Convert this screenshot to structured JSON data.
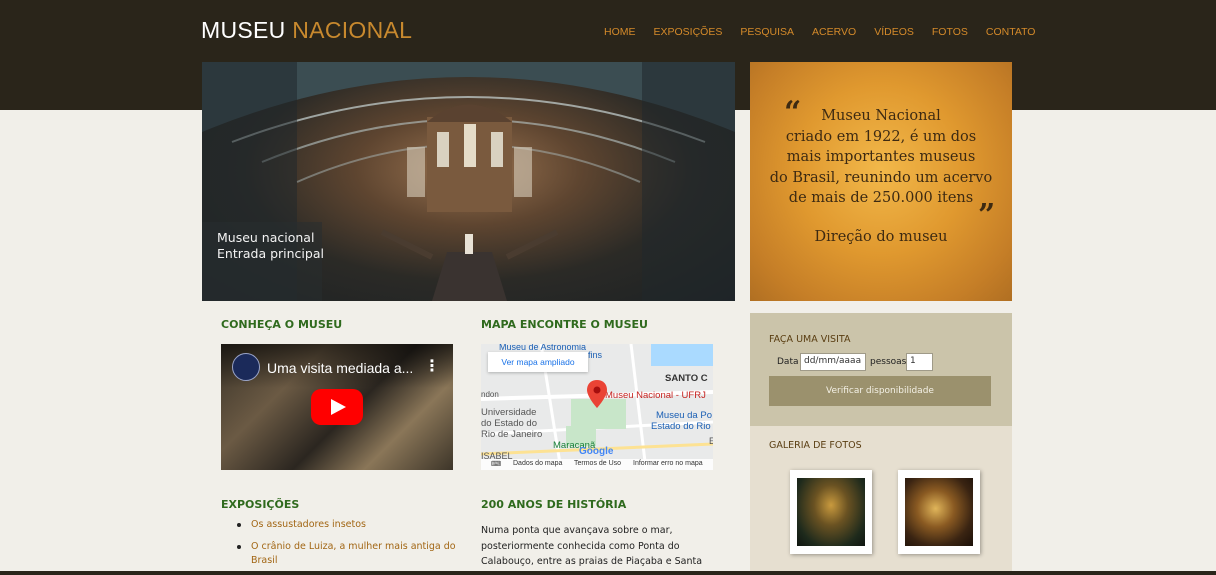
{
  "header": {
    "logo_part1": "MUSEU",
    "logo_part2": "NACIONAL",
    "nav": [
      "HOME",
      "EXPOSIÇÕES",
      "PESQUISA",
      "ACERVO",
      "VÍDEOS",
      "FOTOS",
      "CONTATO"
    ]
  },
  "hero": {
    "caption_line1": "Museu nacional",
    "caption_line2": "Entrada principal"
  },
  "quote": {
    "open_mark": "“",
    "close_mark": "”",
    "lines": [
      "Museu Nacional",
      "criado em 1922, é um dos",
      "mais importantes museus",
      "do Brasil, reunindo um acervo",
      "de mais de 250.000 itens"
    ],
    "signature": "Direção do museu"
  },
  "sections": {
    "conheca": "CONHEÇA O MUSEU",
    "mapa": "MAPA ENCONTRE O MUSEU",
    "exposicoes": "EXPOSIÇÕES",
    "historia": "200 ANOS DE HISTÓRIA"
  },
  "video": {
    "title": "Uma visita mediada a...",
    "menu": "⋮"
  },
  "map": {
    "button": "Ver mapa ampliado",
    "labels": {
      "museu_astronomia": "Museu de Astronomia",
      "fins": "fins",
      "santo": "SANTO C",
      "ndon": "ndon",
      "museu_nacional": "Museu Nacional - UFRJ",
      "museu_da_po": "Museu da Po",
      "estado_do_rio": "Estado do Rio",
      "universidade": "Universidade",
      "do_estado": "do Estado do",
      "rio_de_janeiro": "Rio de Janeiro",
      "maracana": "Maracanã",
      "google": "Google",
      "isabel": "ISABEL",
      "e": "E"
    },
    "footer": [
      "Dados do mapa",
      "Termos de Uso",
      "Informar erro no mapa"
    ]
  },
  "exposicoes_list": [
    "Os assustadores insetos",
    "O crânio de Luiza, a mulher mais antiga do Brasil"
  ],
  "historia_text": "Numa ponta que avançava sobre o mar, posteriormente conhecida como Ponta do Calabouço, entre as praias de Piaçaba e Santa Luzia, no centro histórico do Rio de Janeiro, se",
  "visit": {
    "title": "FAÇA UMA VISITA",
    "data_label": "Data",
    "data_placeholder": "dd/mm/aaaa",
    "pessoas_label": "pessoas",
    "pessoas_value": "1",
    "button": "Verificar disponibilidade"
  },
  "gallery": {
    "title": "GALERIA DE FOTOS"
  },
  "colors": {
    "header_bg": "#2a251a",
    "accent": "#d48a2a",
    "section_green": "#2f6a1d"
  }
}
